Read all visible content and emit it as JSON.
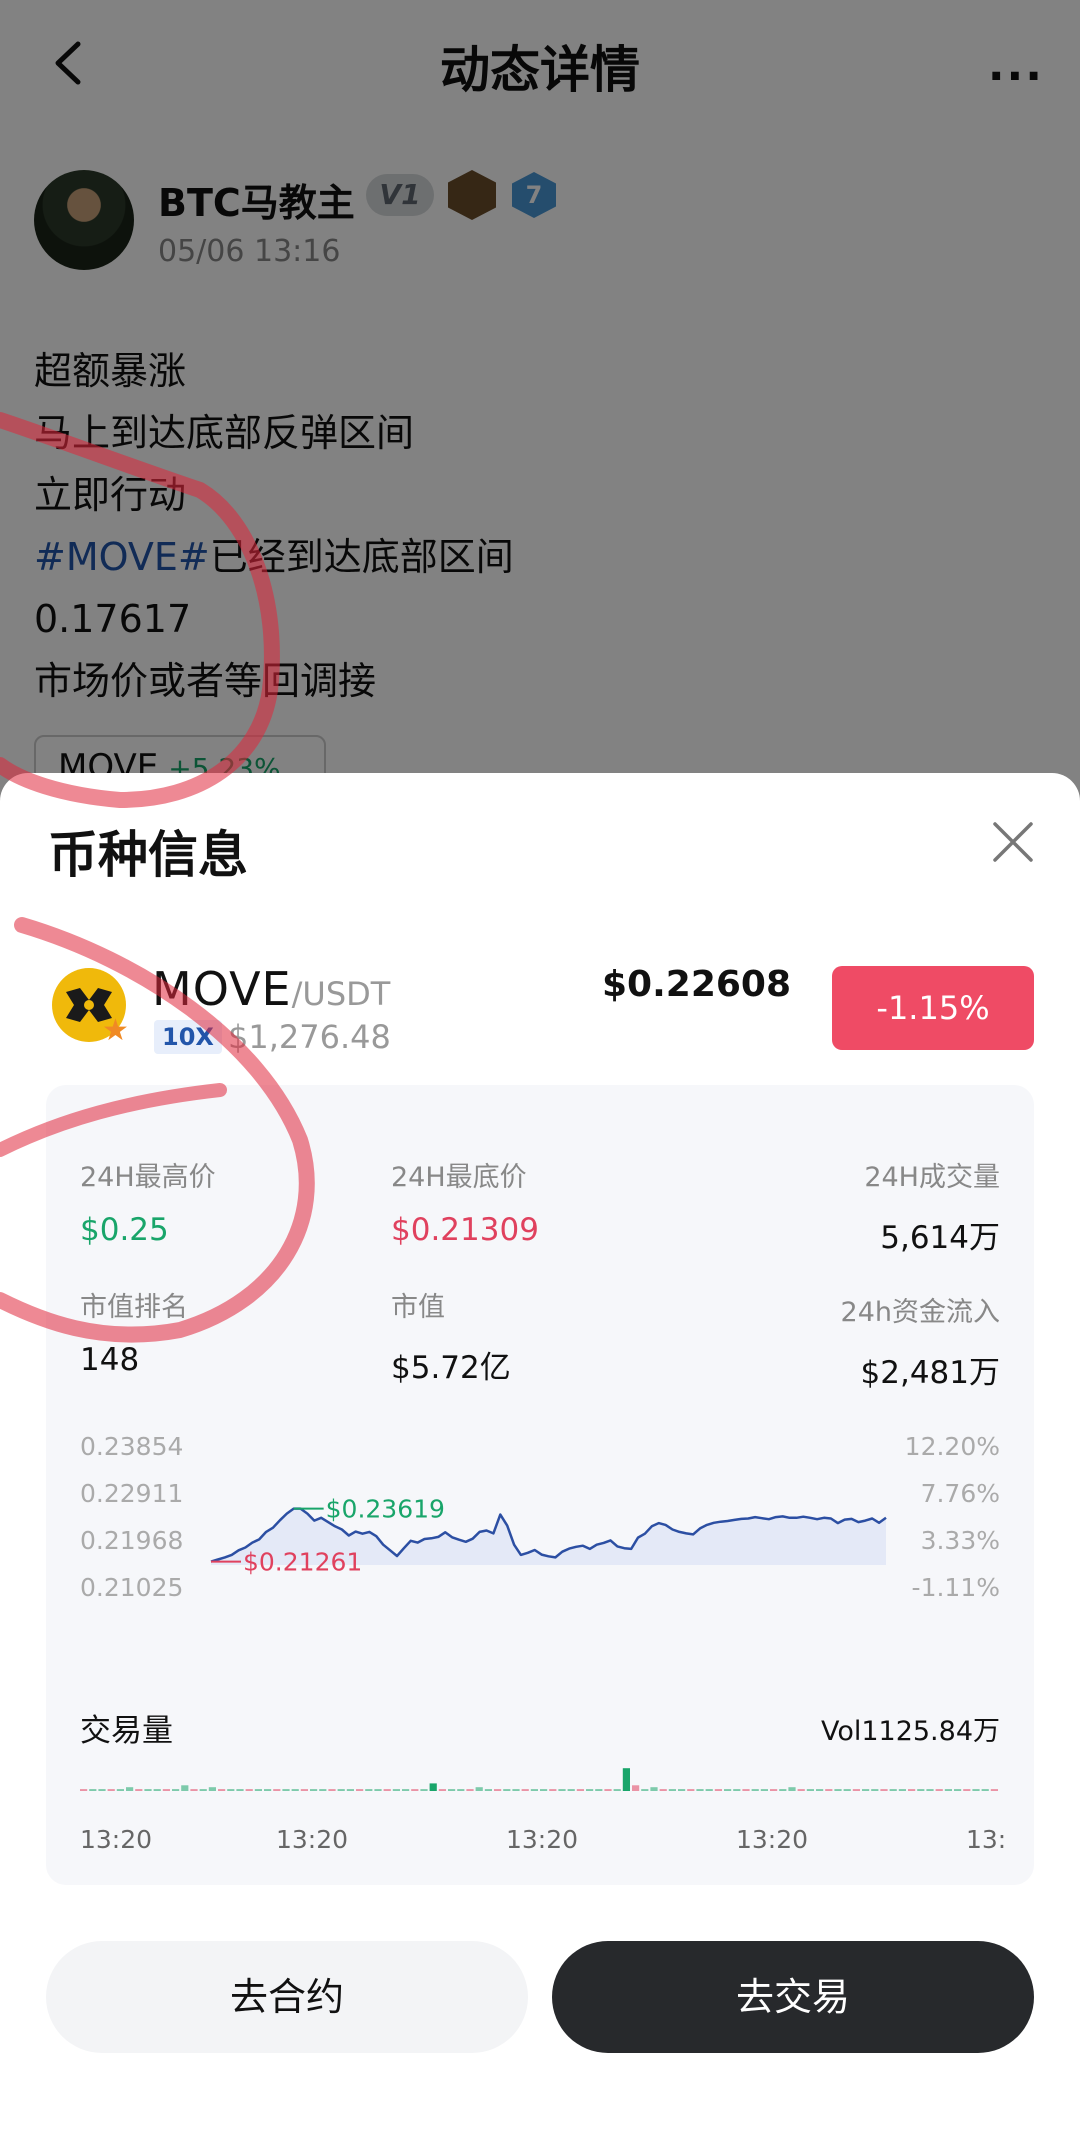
{
  "header": {
    "title": "动态详情",
    "more_label": "..."
  },
  "author": {
    "name": "BTC马教主",
    "vip_badge": "V1",
    "level_badge": "7",
    "time": "05/06 13:16"
  },
  "post": {
    "lines": [
      "超额暴涨",
      "马上到达底部反弹区间",
      "立即行动"
    ],
    "hashtag": "#MOVE#",
    "hashtag_rest": "已经到达底部区间",
    "price_line": "0.17617",
    "last_line": "市场价或者等回调接"
  },
  "coin_chip": {
    "symbol": "MOVE",
    "change": "+5.23%"
  },
  "sheet": {
    "title": "币种信息",
    "coin": {
      "base": "MOVE",
      "quote": "/USDT",
      "leverage": "10X",
      "volume": "$1,276.48",
      "price": "$0.22608",
      "change": "-1.15%"
    },
    "stats": {
      "high_label": "24H最高价",
      "high": "$0.25",
      "low_label": "24H最底价",
      "low": "$0.21309",
      "volume_label": "24H成交量",
      "volume": "5,614万",
      "rank_label": "市值排名",
      "rank": "148",
      "mcap_label": "市值",
      "mcap": "$5.72亿",
      "inflow_label": "24h资金流入",
      "inflow": "$2,481万"
    },
    "volume_title": "交易量",
    "volume_total": "Vol1125.84万",
    "x_ticks": [
      "13:20",
      "13:20",
      "13:20",
      "13:20",
      "13:"
    ],
    "buttons": {
      "contract": "去合约",
      "trade": "去交易"
    }
  },
  "chart_data": {
    "type": "line",
    "y_labels_left": [
      "0.23854",
      "0.22911",
      "0.21968",
      "0.21025"
    ],
    "y_labels_right": [
      "12.20%",
      "7.76%",
      "3.33%",
      "-1.11%"
    ],
    "ylim": [
      0.21025,
      0.23854
    ],
    "max_annotation": "$0.23619",
    "min_annotation": "$0.21261",
    "values": [
      0.2112,
      0.2118,
      0.2124,
      0.2131,
      0.2144,
      0.2152,
      0.2166,
      0.2175,
      0.2196,
      0.2208,
      0.2229,
      0.2248,
      0.2262,
      0.2262,
      0.2248,
      0.2228,
      0.2236,
      0.2224,
      0.2212,
      0.2203,
      0.2186,
      0.2197,
      0.2191,
      0.2196,
      0.2184,
      0.216,
      0.2144,
      0.2128,
      0.215,
      0.2171,
      0.2166,
      0.2176,
      0.2178,
      0.2182,
      0.2195,
      0.2181,
      0.2174,
      0.2168,
      0.2177,
      0.2196,
      0.22,
      0.2192,
      0.2245,
      0.2214,
      0.216,
      0.2131,
      0.2137,
      0.2145,
      0.2132,
      0.2127,
      0.2124,
      0.214,
      0.2149,
      0.2154,
      0.2157,
      0.2148,
      0.216,
      0.2165,
      0.2172,
      0.2155,
      0.215,
      0.2148,
      0.218,
      0.2191,
      0.2212,
      0.2221,
      0.2216,
      0.2203,
      0.2196,
      0.2192,
      0.2189,
      0.2206,
      0.2216,
      0.2222,
      0.2225,
      0.2227,
      0.223,
      0.2233,
      0.2234,
      0.2238,
      0.2235,
      0.2232,
      0.2238,
      0.224,
      0.2236,
      0.2236,
      0.2239,
      0.2236,
      0.2232,
      0.2236,
      0.2234,
      0.2221,
      0.2231,
      0.2233,
      0.2224,
      0.2228,
      0.2234,
      0.2222,
      0.2236
    ],
    "volume_bars": [
      1,
      1,
      1,
      1,
      1,
      2,
      1,
      1,
      1,
      1,
      1,
      3,
      1,
      1,
      2,
      1,
      1,
      1,
      1,
      1,
      1,
      1,
      1,
      1,
      1,
      1,
      1,
      1,
      1,
      1,
      1,
      1,
      1,
      1,
      1,
      1,
      1,
      1,
      4,
      1,
      1,
      1,
      1,
      2,
      1,
      1,
      1,
      1,
      1,
      1,
      1,
      1,
      1,
      1,
      1,
      1,
      1,
      1,
      1,
      12,
      3,
      1,
      2,
      1,
      1,
      1,
      1,
      1,
      1,
      1,
      1,
      1,
      1,
      1,
      1,
      1,
      1,
      2,
      1,
      1,
      1,
      1,
      1,
      1,
      1,
      1,
      1,
      1,
      1,
      1,
      1,
      1,
      1,
      1,
      1,
      1,
      1,
      1,
      1,
      1
    ],
    "colors": {
      "line": "#2c4fa3",
      "fill": "#dde3f5",
      "up": "#19a56a",
      "down": "#e0415e"
    }
  }
}
